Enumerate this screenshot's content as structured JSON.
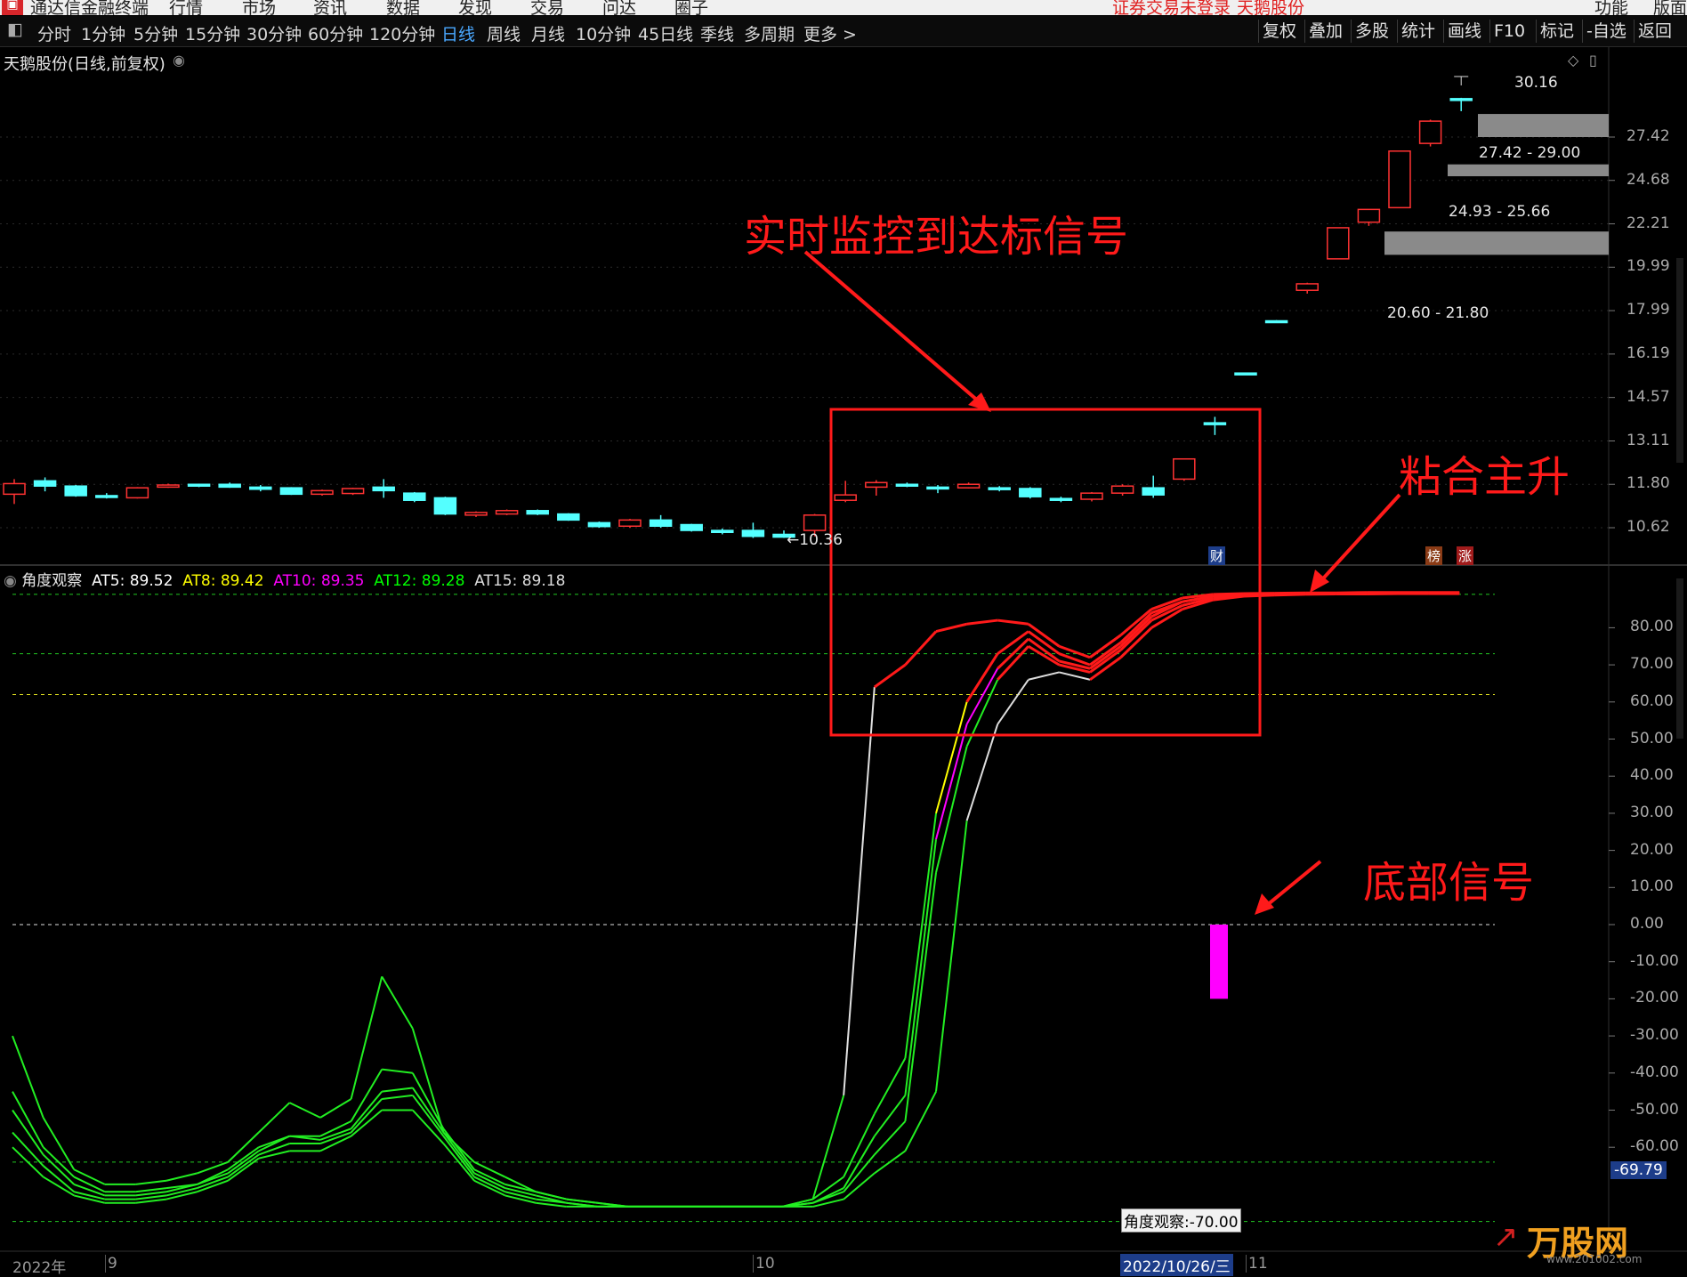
{
  "titlebar": {
    "app_name": "通达信金融终端",
    "menu": [
      "行情",
      "市场",
      "资讯",
      "数据",
      "发现",
      "交易",
      "问达",
      "圈子"
    ],
    "notice": "证券交易未登录",
    "stock_name": "天鹅股份",
    "right": [
      "功能",
      "版面"
    ]
  },
  "toolbar": {
    "periods": [
      "分时",
      "1分钟",
      "5分钟",
      "15分钟",
      "30分钟",
      "60分钟",
      "120分钟",
      "日线",
      "周线",
      "月线",
      "10分钟",
      "45日线",
      "季线",
      "多周期",
      "更多 >"
    ],
    "active_period": "日线",
    "right_buttons": [
      "复权",
      "叠加",
      "多股",
      "统计",
      "画线",
      "F10",
      "标记",
      "-自选",
      "返回"
    ]
  },
  "main_chart": {
    "title": "天鹅股份(日线,前复权)",
    "price_axis": [
      "27.42",
      "24.68",
      "22.21",
      "19.99",
      "17.99",
      "16.19",
      "14.57",
      "13.11",
      "11.80",
      "10.62"
    ],
    "high_label": "30.16",
    "low_label": "10.36",
    "gap_zones": [
      "27.42 - 29.00",
      "24.93 - 25.66",
      "20.60 - 21.80"
    ],
    "badges": [
      "财",
      "榜",
      "涨"
    ],
    "candles": [
      {
        "o": 11.52,
        "c": 11.82,
        "h": 11.95,
        "l": 11.25
      },
      {
        "o": 11.9,
        "c": 11.75,
        "h": 12.0,
        "l": 11.6
      },
      {
        "o": 11.75,
        "c": 11.48,
        "h": 11.78,
        "l": 11.45
      },
      {
        "o": 11.48,
        "c": 11.44,
        "h": 11.55,
        "l": 11.4
      },
      {
        "o": 11.42,
        "c": 11.7,
        "h": 11.72,
        "l": 11.4
      },
      {
        "o": 11.72,
        "c": 11.78,
        "h": 11.82,
        "l": 11.7
      },
      {
        "o": 11.8,
        "c": 11.76,
        "h": 11.82,
        "l": 11.72
      },
      {
        "o": 11.8,
        "c": 11.72,
        "h": 11.85,
        "l": 11.7
      },
      {
        "o": 11.72,
        "c": 11.66,
        "h": 11.78,
        "l": 11.6
      },
      {
        "o": 11.7,
        "c": 11.52,
        "h": 11.72,
        "l": 11.5
      },
      {
        "o": 11.52,
        "c": 11.62,
        "h": 11.65,
        "l": 11.48
      },
      {
        "o": 11.54,
        "c": 11.68,
        "h": 11.7,
        "l": 11.5
      },
      {
        "o": 11.72,
        "c": 11.62,
        "h": 11.95,
        "l": 11.42
      },
      {
        "o": 11.55,
        "c": 11.35,
        "h": 11.58,
        "l": 11.3
      },
      {
        "o": 11.42,
        "c": 10.98,
        "h": 11.45,
        "l": 10.95
      },
      {
        "o": 10.95,
        "c": 11.02,
        "h": 11.05,
        "l": 10.9
      },
      {
        "o": 10.98,
        "c": 11.07,
        "h": 11.1,
        "l": 10.95
      },
      {
        "o": 11.07,
        "c": 10.98,
        "h": 11.1,
        "l": 10.95
      },
      {
        "o": 10.98,
        "c": 10.82,
        "h": 11.0,
        "l": 10.8
      },
      {
        "o": 10.75,
        "c": 10.65,
        "h": 10.78,
        "l": 10.62
      },
      {
        "o": 10.66,
        "c": 10.82,
        "h": 10.85,
        "l": 10.62
      },
      {
        "o": 10.82,
        "c": 10.66,
        "h": 10.95,
        "l": 10.62
      },
      {
        "o": 10.7,
        "c": 10.55,
        "h": 10.72,
        "l": 10.52
      },
      {
        "o": 10.55,
        "c": 10.5,
        "h": 10.6,
        "l": 10.45
      },
      {
        "o": 10.55,
        "c": 10.4,
        "h": 10.75,
        "l": 10.36
      },
      {
        "o": 10.45,
        "c": 10.38,
        "h": 10.55,
        "l": 10.36
      },
      {
        "o": 10.55,
        "c": 10.95,
        "h": 10.98,
        "l": 10.4
      },
      {
        "o": 11.35,
        "c": 11.5,
        "h": 11.9,
        "l": 11.3
      },
      {
        "o": 11.72,
        "c": 11.85,
        "h": 11.92,
        "l": 11.48
      },
      {
        "o": 11.8,
        "c": 11.76,
        "h": 11.85,
        "l": 11.72
      },
      {
        "o": 11.72,
        "c": 11.68,
        "h": 11.78,
        "l": 11.55
      },
      {
        "o": 11.7,
        "c": 11.8,
        "h": 11.85,
        "l": 11.68
      },
      {
        "o": 11.7,
        "c": 11.66,
        "h": 11.75,
        "l": 11.6
      },
      {
        "o": 11.68,
        "c": 11.45,
        "h": 11.72,
        "l": 11.4
      },
      {
        "o": 11.4,
        "c": 11.35,
        "h": 11.45,
        "l": 11.3
      },
      {
        "o": 11.38,
        "c": 11.55,
        "h": 11.58,
        "l": 11.32
      },
      {
        "o": 11.55,
        "c": 11.75,
        "h": 11.8,
        "l": 11.48
      },
      {
        "o": 11.7,
        "c": 11.5,
        "h": 12.05,
        "l": 11.42
      },
      {
        "o": 11.95,
        "c": 12.55,
        "h": 12.55,
        "l": 11.9
      },
      {
        "o": 13.7,
        "c": 13.65,
        "h": 13.9,
        "l": 13.3
      },
      {
        "o": 15.46,
        "c": 15.4,
        "h": 15.48,
        "l": 15.4
      },
      {
        "o": 17.55,
        "c": 17.5,
        "h": 17.58,
        "l": 17.5
      },
      {
        "o": 18.9,
        "c": 19.2,
        "h": 19.25,
        "l": 18.75
      },
      {
        "o": 20.4,
        "c": 22.0,
        "h": 22.0,
        "l": 20.4
      },
      {
        "o": 22.3,
        "c": 23.0,
        "h": 23.0,
        "l": 22.1
      },
      {
        "o": 23.1,
        "c": 26.5,
        "h": 26.5,
        "l": 23.1
      },
      {
        "o": 27.0,
        "c": 28.5,
        "h": 28.6,
        "l": 26.8
      },
      {
        "o": 30.1,
        "c": 30.05,
        "h": 30.16,
        "l": 29.2
      }
    ]
  },
  "annotations": {
    "box_label": "实时监控到达标信号",
    "converge_label": "粘合主升",
    "bottom_label": "底部信号"
  },
  "indicator": {
    "name": "角度观察",
    "series": [
      {
        "name": "AT5",
        "value": "89.52",
        "color": "#ffffff"
      },
      {
        "name": "AT8",
        "value": "89.42",
        "color": "#ffff00"
      },
      {
        "name": "AT10",
        "value": "89.35",
        "color": "#ff00ff"
      },
      {
        "name": "AT12",
        "value": "89.28",
        "color": "#00ff00"
      },
      {
        "name": "AT15",
        "value": "89.18",
        "color": "#dddddd"
      }
    ],
    "axis_ticks": [
      "80.00",
      "70.00",
      "60.00",
      "50.00",
      "40.00",
      "30.00",
      "20.00",
      "10.00",
      "0.00",
      "-10.00",
      "-20.00",
      "-30.00",
      "-40.00",
      "-50.00",
      "-60.00"
    ],
    "cursor_value": "-69.79",
    "tooltip": "角度观察:-70.00",
    "bottom_signal": {
      "from": 0,
      "to": -20
    },
    "lines": {
      "AT5": [
        -30,
        -52,
        -66,
        -70,
        -70,
        -69,
        -67,
        -64,
        -56,
        -48,
        -52,
        -47,
        -14,
        -28,
        -56,
        -64,
        -68,
        -72,
        -74,
        -75,
        -76,
        -76,
        -76,
        -76,
        -76,
        -76,
        -74,
        -46,
        64,
        70,
        79,
        81,
        82,
        81,
        75,
        72,
        78,
        85,
        88,
        89,
        89.2,
        89.3,
        89.4,
        89.4,
        89.5,
        89.5,
        89.5,
        89.52
      ],
      "AT8": [
        -45,
        -60,
        -68,
        -72,
        -72,
        -71,
        -70,
        -66,
        -60,
        -57,
        -57,
        -53,
        -39,
        -40,
        -55,
        -66,
        -70,
        -72,
        -74,
        -75,
        -76,
        -76,
        -76,
        -76,
        -76,
        -76,
        -74,
        -68,
        -51,
        -36,
        30,
        60,
        73,
        79,
        73,
        70,
        76,
        84,
        87,
        88.5,
        89,
        89.1,
        89.2,
        89.3,
        89.4,
        89.4,
        89.42,
        89.42
      ],
      "AT10": [
        -50,
        -62,
        -70,
        -73,
        -73,
        -72,
        -70,
        -67,
        -61,
        -57,
        -58,
        -55,
        -45,
        -44,
        -56,
        -67,
        -71,
        -73,
        -75,
        -76,
        -76,
        -76,
        -76,
        -76,
        -76,
        -76,
        -75,
        -71,
        -57,
        -46,
        23,
        54,
        69,
        77,
        71,
        69,
        75,
        83,
        87,
        88.5,
        89,
        89.1,
        89.2,
        89.3,
        89.3,
        89.35,
        89.35,
        89.35
      ],
      "AT12": [
        -56,
        -65,
        -72,
        -74,
        -74,
        -73,
        -71,
        -68,
        -62,
        -59,
        -59,
        -56,
        -47,
        -46,
        -57,
        -68,
        -72,
        -74,
        -75,
        -76,
        -76,
        -76,
        -76,
        -76,
        -76,
        -76,
        -75,
        -72,
        -62,
        -53,
        14,
        48,
        66,
        75,
        70,
        68,
        74,
        82,
        86,
        88,
        88.8,
        89,
        89.1,
        89.2,
        89.2,
        89.28,
        89.28,
        89.28
      ],
      "AT15": [
        -60,
        -68,
        -73,
        -75,
        -75,
        -74,
        -72,
        -69,
        -63,
        -61,
        -61,
        -57,
        -50,
        -50,
        -59,
        -69,
        -73,
        -75,
        -76,
        -76,
        -76,
        -76,
        -76,
        -76,
        -76,
        -76,
        -76,
        -74,
        -67,
        -61,
        -45,
        28,
        54,
        66,
        68,
        66,
        72,
        80,
        85,
        87.5,
        88.5,
        88.8,
        89,
        89.1,
        89.1,
        89.18,
        89.18,
        89.18
      ]
    }
  },
  "time_axis": {
    "labels": [
      "2022年",
      "9",
      "10",
      "11"
    ],
    "highlight_date": "2022/10/26/三"
  },
  "watermark": {
    "text": "万股网",
    "url": "www.201002.com"
  }
}
